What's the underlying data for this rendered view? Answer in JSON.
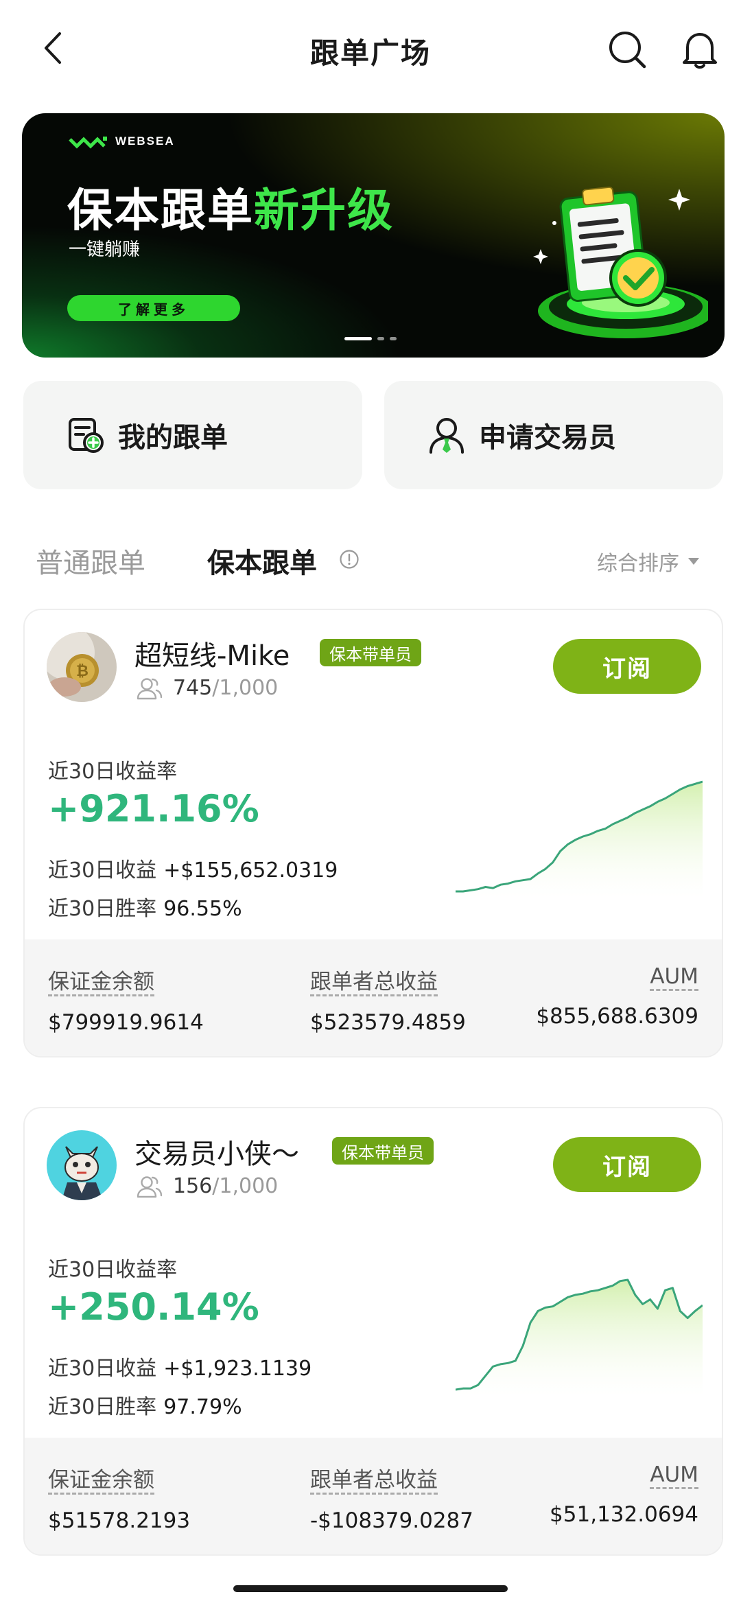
{
  "header": {
    "title": "跟单广场"
  },
  "banner": {
    "brand": "WEBSEA",
    "headline_white": "保本跟单",
    "headline_green": "新升级",
    "subtitle": "一键躺赚",
    "cta": "了解更多",
    "page_count": 3,
    "active_page": 1
  },
  "actions": {
    "my_copy": "我的跟单",
    "apply_trader": "申请交易员"
  },
  "tabs": {
    "normal": "普通跟单",
    "protected": "保本跟单",
    "sort": "综合排序"
  },
  "traders": [
    {
      "name": "超短线-Mike",
      "badge": "保本带单员",
      "followers_current": "745",
      "followers_max": "/1,000",
      "subscribe": "订阅",
      "roi_label": "近30日收益率",
      "roi": "+921.16%",
      "profit_label": "近30日收益",
      "profit": "+$155,652.0319",
      "winrate_label": "近30日胜率",
      "winrate": "96.55%",
      "margin_label": "保证金余额",
      "margin": "$799919.9614",
      "follower_profit_label": "跟单者总收益",
      "follower_profit": "$523579.4859",
      "aum_label": "AUM",
      "aum": "$855,688.6309",
      "trend": [
        2,
        2,
        3,
        4,
        6,
        5,
        8,
        9,
        11,
        12,
        13,
        18,
        22,
        28,
        38,
        44,
        48,
        51,
        53,
        56,
        58,
        62,
        65,
        68,
        72,
        75,
        78,
        82,
        85,
        89,
        93,
        96,
        98,
        100
      ]
    },
    {
      "name": "交易员小侠～",
      "badge": "保本带单员",
      "followers_current": "156",
      "followers_max": "/1,000",
      "subscribe": "订阅",
      "roi_label": "近30日收益率",
      "roi": "+250.14%",
      "profit_label": "近30日收益",
      "profit": "+$1,923.1139",
      "winrate_label": "近30日胜率",
      "winrate": "97.79%",
      "margin_label": "保证金余额",
      "margin": "$51578.2193",
      "follower_profit_label": "跟单者总收益",
      "follower_profit": "-$108379.0287",
      "aum_label": "AUM",
      "aum": "$51,132.0694",
      "trend": [
        2,
        3,
        3,
        6,
        14,
        22,
        24,
        25,
        27,
        40,
        60,
        70,
        73,
        74,
        78,
        82,
        84,
        85,
        87,
        88,
        90,
        92,
        96,
        97,
        84,
        76,
        80,
        72,
        88,
        90,
        70,
        64,
        70,
        75
      ]
    }
  ],
  "colors": {
    "accent_green": "#7fb317",
    "roi_green": "#2fb67c",
    "badge_green": "#6fa516",
    "banner_green": "#3ee64a"
  }
}
